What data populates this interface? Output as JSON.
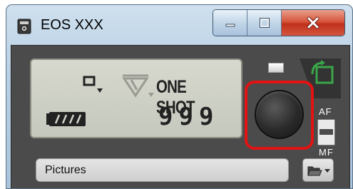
{
  "window": {
    "title": "EOS XXX",
    "app_icon": "camera-app-icon",
    "controls": {
      "minimize": "minimize-icon",
      "maximize": "maximize-icon",
      "close": "close-icon"
    }
  },
  "lcd": {
    "drive_mode_icon": "single-shot-drive-icon",
    "metering_icon": "metering-mode-icon",
    "af_mode": "ONE SHOT",
    "battery_icon": "battery-full-icon",
    "shots_remaining": "999"
  },
  "controls": {
    "live_view_indicator": "live-view-icon",
    "rotate_icon": "rotate-icon",
    "shutter_icon": "shutter-button",
    "focus_af_label": "AF",
    "focus_mf_label": "MF"
  },
  "folder": {
    "value": "Pictures",
    "button_icon": "folder-open-icon"
  },
  "colors": {
    "highlight": "#e21313",
    "body": "#4b4b4b",
    "lcd": "#c8cbc0"
  }
}
